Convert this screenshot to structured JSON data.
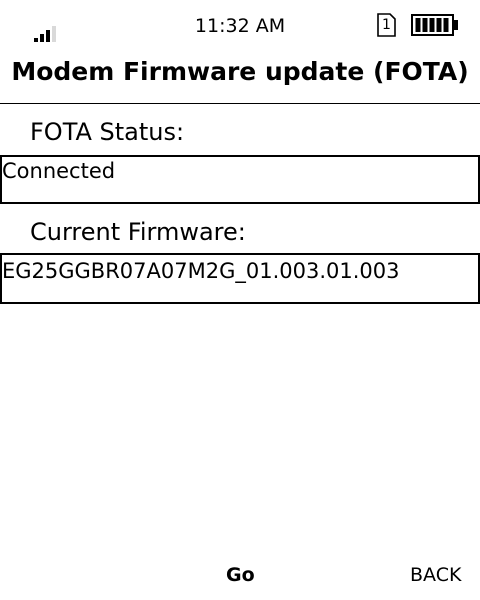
{
  "status_bar": {
    "time": "11:32 AM",
    "signal_icon": "signal-strength-icon",
    "signal_level": 2,
    "sim_slot": "1",
    "sim_icon": "sim-card-icon",
    "battery_icon": "battery-icon",
    "battery_level": 1.0
  },
  "title": "Modem Firmware update (FOTA)",
  "fota_status": {
    "label": "FOTA Status:",
    "value": "Connected"
  },
  "current_firmware": {
    "label": "Current Firmware:",
    "value": "EG25GGBR07A07M2G_01.003.01.003"
  },
  "softkeys": {
    "center": "Go",
    "right": "BACK"
  }
}
